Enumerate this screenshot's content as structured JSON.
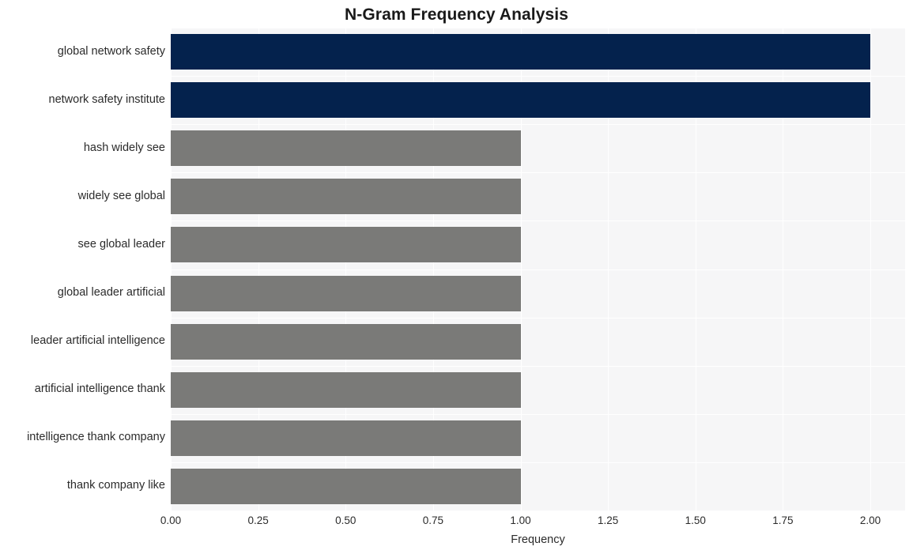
{
  "chart_data": {
    "type": "bar",
    "orientation": "horizontal",
    "title": "N-Gram Frequency Analysis",
    "xlabel": "Frequency",
    "ylabel": "",
    "categories": [
      "global network safety",
      "network safety institute",
      "hash widely see",
      "widely see global",
      "see global leader",
      "global leader artificial",
      "leader artificial intelligence",
      "artificial intelligence thank",
      "intelligence thank company",
      "thank company like"
    ],
    "values": [
      2,
      2,
      1,
      1,
      1,
      1,
      1,
      1,
      1,
      1
    ],
    "bar_colors": [
      "#04224d",
      "#04224d",
      "#7a7a78",
      "#7a7a78",
      "#7a7a78",
      "#7a7a78",
      "#7a7a78",
      "#7a7a78",
      "#7a7a78",
      "#7a7a78"
    ],
    "xlim": [
      0,
      2
    ],
    "xticks": [
      0,
      0.25,
      0.5,
      0.75,
      1,
      1.25,
      1.5,
      1.75,
      2
    ],
    "xtick_labels": [
      "0.00",
      "0.25",
      "0.50",
      "0.75",
      "1.00",
      "1.25",
      "1.50",
      "1.75",
      "2.00"
    ],
    "grid": true,
    "grid_color": "#ffffff",
    "plot_background": "#f6f6f7",
    "figure_background": "#ffffff",
    "legend": null,
    "highlight_color": "#04224d",
    "base_color": "#7a7a78"
  }
}
